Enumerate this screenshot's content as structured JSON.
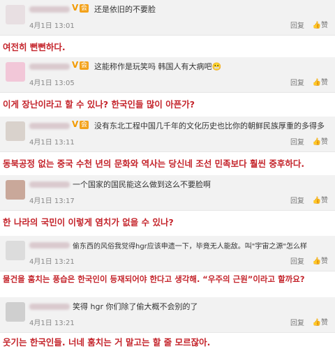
{
  "actions": {
    "reply_label": "回复",
    "like_label": "赞"
  },
  "comments": [
    {
      "vip": "V",
      "text": "还是依旧的不要脸",
      "date": "4月1日 13:01",
      "translation": "여전히 뻔뻔하다."
    },
    {
      "vip": "V",
      "text": "这能称作是玩笑吗 韩国人有大病吧",
      "date": "4月1日 13:05",
      "translation": "이게 장난이라고 할 수 있나? 한국인들 많이 아픈가?"
    },
    {
      "vip": "V",
      "text": "没有东北工程中国几千年的文化历史也比你的朝鲜民族厚重的多得多",
      "date": "4月1日 13:11",
      "translation": "동북공정 없는 중국 수천 년의 문화와 역사는 당신네 조선 민족보다 훨씬 중후하다."
    },
    {
      "vip": "",
      "text": "一个国家的国民能这么做到这么不要脸啊",
      "date": "4月1日 13:17",
      "translation": "한 나라의 국민이 이렇게 염치가 없을 수 있나?"
    },
    {
      "vip": "",
      "text": "偷东西的风俗我觉得hgr应该申遗一下，毕竟无人能敌。叫\"宇宙之源\"怎么样",
      "date": "4月1日 13:21",
      "translation": "물건을 훔치는 풍습은 한국인이 등재되어야 한다고 생각해. “우주의 근원”이라고 할까요?"
    },
    {
      "vip": "",
      "text": "笑得 hgr 你们除了偷大概不会别的了",
      "date": "4月1日 13:21",
      "translation": "웃기는 한국인들. 너네 훔치는 거 말고는 할 줄 모르잖아."
    }
  ]
}
